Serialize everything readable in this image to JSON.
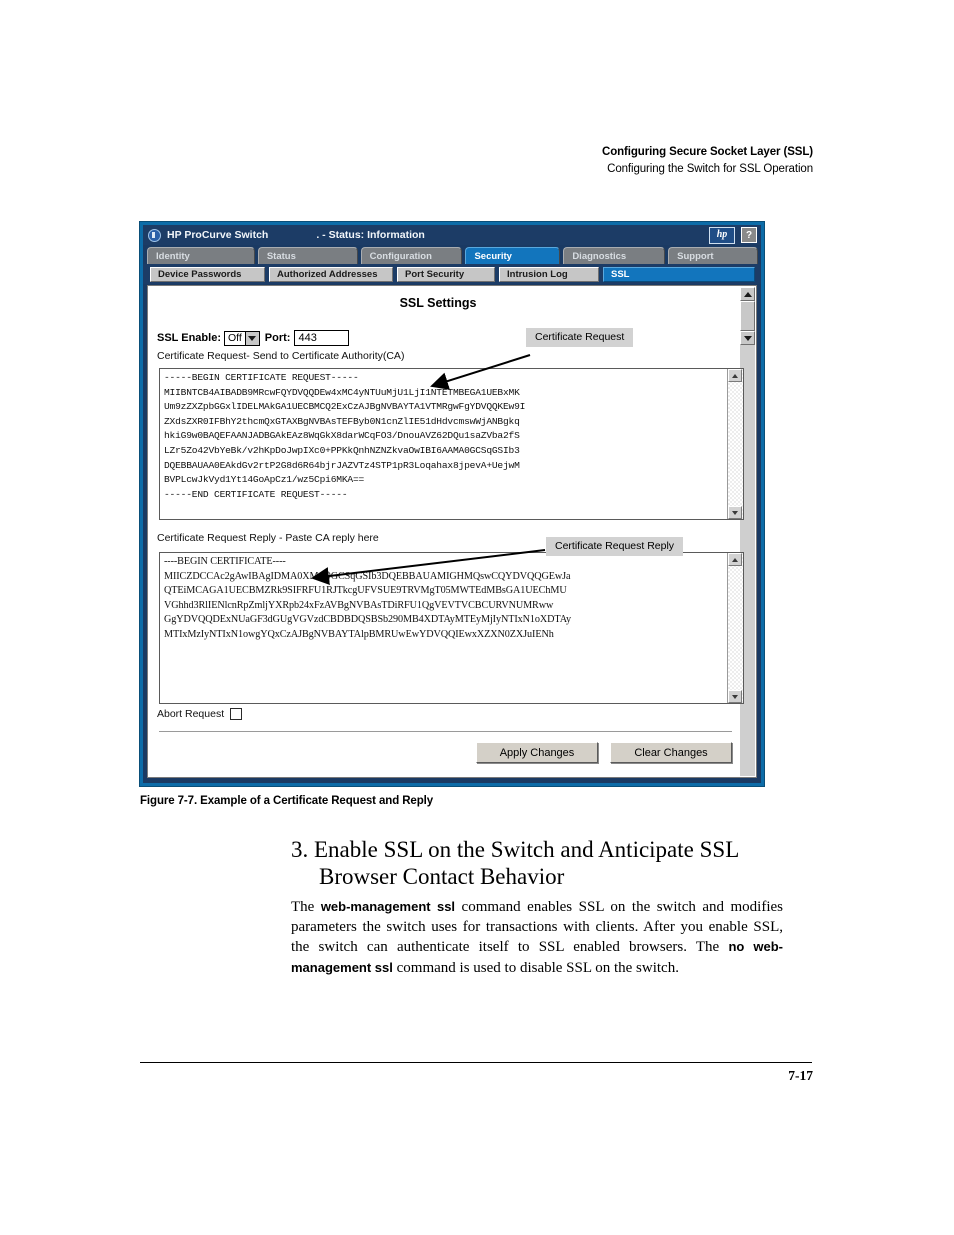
{
  "running_head": {
    "line1": "Configuring Secure Socket Layer (SSL)",
    "line2": "Configuring the Switch for SSL Operation"
  },
  "window": {
    "title": "HP ProCurve Switch",
    "status": ". - Status: Information",
    "logo_text": "hp",
    "help_label": "?",
    "main_tabs": [
      {
        "label": "Identity",
        "selected": false
      },
      {
        "label": "Status",
        "selected": false
      },
      {
        "label": "Configuration",
        "selected": false
      },
      {
        "label": "Security",
        "selected": true
      },
      {
        "label": "Diagnostics",
        "selected": false
      },
      {
        "label": "Support",
        "selected": false
      }
    ],
    "sub_tabs": [
      {
        "label": "Device Passwords",
        "selected": false
      },
      {
        "label": "Authorized Addresses",
        "selected": false
      },
      {
        "label": "Port Security",
        "selected": false
      },
      {
        "label": "Intrusion Log",
        "selected": false
      },
      {
        "label": "SSL",
        "selected": true
      }
    ]
  },
  "panel": {
    "title": "SSL Settings",
    "ssl_enable_label": "SSL Enable:",
    "ssl_enable_value": "Off",
    "port_label": "Port:",
    "port_value": "443",
    "request_label": "Certificate Request- Send to Certificate Authority(CA)",
    "reply_label": "Certificate Request Reply - Paste CA reply here",
    "abort_label": "Abort Request",
    "abort_checked": false,
    "apply_label": "Apply Changes",
    "clear_label": "Clear Changes",
    "certificate_request_text": "-----BEGIN CERTIFICATE REQUEST-----\nMIIBNTCB4AIBADB9MRcwFQYDVQQDEw4xMC4yNTUuMjU1LjI1NTETMBEGA1UEBxMK\nUm9zZXZpbGGxlIDELMAkGA1UECBMCQ2ExCzAJBgNVBAYTA1VTMRgwFgYDVQQKEw9I\nZXdsZXR0IFBhY2thcmQxGTAXBgNVBAsTEFByb0N1cnZlIE51dHdvcmswWjANBgkq\nhkiG9w0BAQEFAANJADBGAkEAz8WqGkX8darWCqFO3/DnouAVZ62DQu1saZVba2fS\nLZr5Zo42VbYeBk/v2hKpDoJwpIXc0+PPKkQnhNZNZkvaOwIBI6AAMA0GCSqGSIb3\nDQEBBAUAA0EAkdGv2rtP2G8d6R64bjrJAZVTz4STP1pR3Loqahax8jpevA+UejwM\nBVPLcwJkVyd1Yt14GoApCz1/wz5Cpi6MKA==\n-----END CERTIFICATE REQUEST-----",
    "certificate_reply_text": "----BEGIN CERTIFICATE----\nMIICZDCCAc2gAwIBAgIDMA0XMA0GCSqGSIb3DQEBBAUAMIGHMQswCQYDVQQGEwJa\nQTEiMCAGA1UECBMZRk9SIFRFU1RJTkcgUFVSUE9TRVMgT05MWTEdMBsGA1UEChMU\nVGhhd3RlIENlcnRpZmljYXRpb24xFzAVBgNVBAsTDiRFU1QgVEVTVCBCURVNUMRww\nGgYDVQQDExNUaGF3dGUgVGVzdCBDBDQSBSb290MB4XDTAyMTEyMjIyNTIxN1oXDTAy\nMTIxMzIyNTIxN1owgYQxCzAJBgNVBAYTAlpBMRUwEwYDVQQIEwxXZXN0ZXJuIENh"
  },
  "figure_caption": "Figure 7-7. Example of a Certificate Request and Reply",
  "callouts": {
    "request": "Certificate Request",
    "reply": "Certificate Request Reply"
  },
  "heading": {
    "line1": "3. Enable SSL on the Switch and Anticipate SSL",
    "line2": "Browser Contact Behavior"
  },
  "paragraph": {
    "p1": "The ",
    "b1": "web-management ssl",
    "p2": "  command enables SSL on the switch and modifies parameters the switch uses for transactions with clients. After you enable SSL, the switch can authenticate itself to SSL enabled browsers. The ",
    "b2": "no web-management ssl",
    "p3": " command is used to disable SSL on the switch."
  },
  "page_number": "7-17"
}
